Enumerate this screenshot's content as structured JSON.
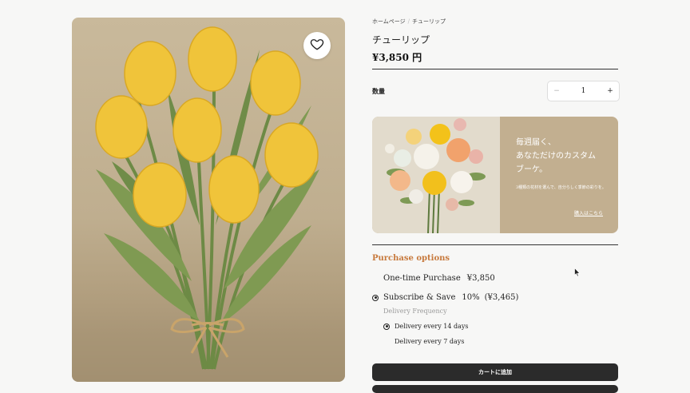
{
  "breadcrumb": {
    "home": "ホームページ",
    "current": "チューリップ"
  },
  "product": {
    "title": "チューリップ",
    "price": "¥3,850 円"
  },
  "quantity": {
    "label": "数量",
    "value": "1",
    "minus": "−",
    "plus": "+"
  },
  "banner": {
    "heading_line1": "毎週届く、",
    "heading_line2": "あなただけのカスタム",
    "heading_line3": "ブーケ。",
    "subtext": "3種類の花材を選んで、自分らしく季節の彩りを。",
    "link": "購入はこちら"
  },
  "purchase_options": {
    "title": "Purchase options",
    "one_time_label": "One-time Purchase",
    "one_time_price": "¥3,850",
    "subscribe_label": "Subscribe & Save",
    "subscribe_discount": "10%",
    "subscribe_price": "(¥3,465)",
    "frequency_label": "Delivery Frequency",
    "frequencies": [
      "Delivery every 14 days",
      "Delivery every 7 days"
    ]
  },
  "cart": {
    "label": "カートに追加"
  },
  "icons": {
    "wishlist": "heart-icon",
    "cursor": "mouse-pointer-icon"
  },
  "colors": {
    "accent": "#c7793c",
    "button": "#2b2b2b",
    "banner": "#c2af90"
  }
}
